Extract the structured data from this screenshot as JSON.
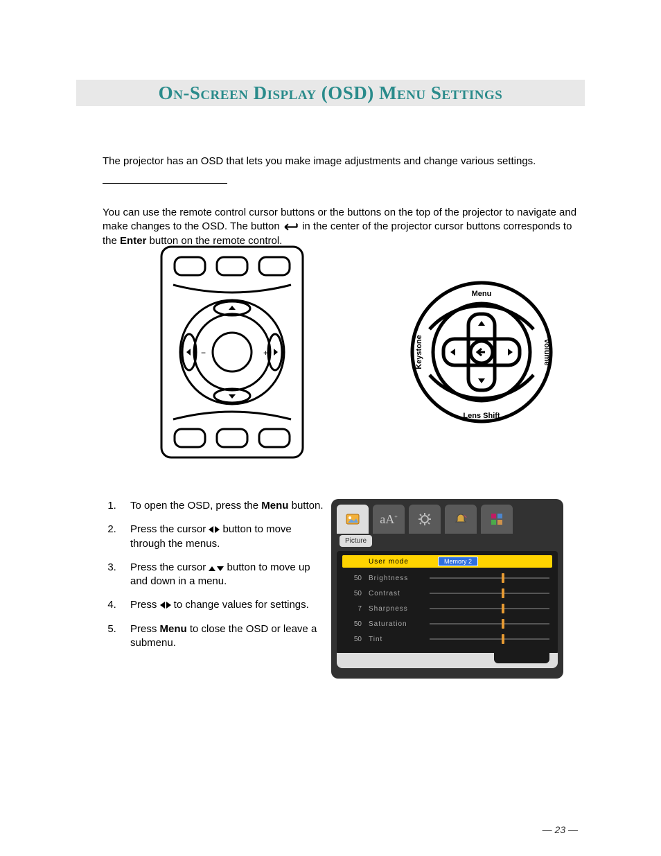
{
  "title": "On-Screen Display (OSD) Menu Settings",
  "intro": "The projector has an OSD that lets you make image adjustments and change various settings.",
  "nav": {
    "part1": "You can use the remote control cursor buttons or the buttons on the top of the projector to navigate and make changes to the OSD. The button ",
    "part2": " in the center of the projector cursor buttons corresponds to the ",
    "enter_word": "Enter",
    "part3": " button on the remote control."
  },
  "remote_labels": {
    "top": "Menu",
    "bottom": "Lens Shift",
    "left": "Keystone",
    "right": "Volume"
  },
  "steps": [
    {
      "pre": "To open the OSD, press the ",
      "bold": "Menu",
      "post": " button."
    },
    {
      "pre": "Press the cursor ",
      "icons": "lr",
      "post": " button to move through the menus."
    },
    {
      "pre": "Press the cursor ",
      "icons": "ud",
      "post": " button to move up and down in a menu."
    },
    {
      "pre": "Press ",
      "icons": "lr",
      "post": " to change values for settings."
    },
    {
      "pre": "Press ",
      "bold": "Menu",
      "post": " to close the OSD or leave a submenu."
    }
  ],
  "osd": {
    "tab_label": "Picture",
    "header": {
      "label": "User mode",
      "badge": "Memory 2"
    },
    "rows": [
      {
        "value": "50",
        "label": "Brightness",
        "pos": 60
      },
      {
        "value": "50",
        "label": "Contrast",
        "pos": 60
      },
      {
        "value": "7",
        "label": "Sharpness",
        "pos": 60
      },
      {
        "value": "50",
        "label": "Saturation",
        "pos": 60
      },
      {
        "value": "50",
        "label": "Tint",
        "pos": 60
      }
    ]
  },
  "page_number": "— 23 —"
}
